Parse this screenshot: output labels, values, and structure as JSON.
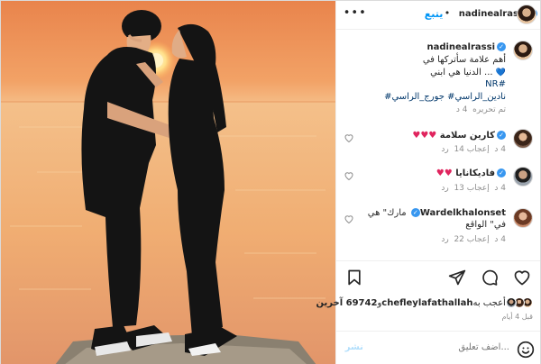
{
  "post": {
    "username": "nadinealrassi",
    "follow_label": "يتبع",
    "more_label": "•••",
    "dot": "•"
  },
  "caption": {
    "username": "nadinealrassi",
    "text_line1": "أهم علامة سأتركها في",
    "text_line2": "... الدنيا هي ابني",
    "heart": "💙",
    "tag_line1": "#NR",
    "tag_line2": "نادين_الراسي# جورج_الراسي#",
    "edited_label": "تم تحريره",
    "time": "4 د"
  },
  "comments": [
    {
      "username": "كارين سلامة",
      "text": "♥♥♥",
      "reply_label": "رد",
      "likes": "إعجاب 14",
      "time": "4 د",
      "avatar": "av-karen"
    },
    {
      "username": "فاديكانايا",
      "text": "♥♥",
      "reply_label": "رد",
      "likes": "إعجاب 13",
      "time": "4 د",
      "avatar": "av-fadi"
    },
    {
      "username": "Wardelkhalonset",
      "text": "مارك\" هي في\" الواقع",
      "reply_label": "رد",
      "likes": "إعجاب 22",
      "time": "4 د",
      "avatar": "av-wardel"
    }
  ],
  "likes_summary": {
    "prefix": "أعجب به",
    "user": "chefleylafathallah",
    "and": "و",
    "others": "69742 آخرين"
  },
  "posted_time": "قبل 4 أيام",
  "add_comment": {
    "placeholder": "...اضف تعليق",
    "post_label": "نشر"
  },
  "colors": {
    "accent": "#0095f6",
    "verified": "#3897f0",
    "heart_red": "#e0245e",
    "secondary_text": "#8e8e8e"
  }
}
